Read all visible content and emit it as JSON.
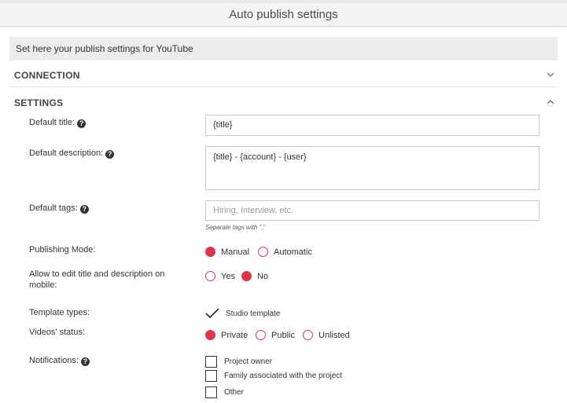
{
  "dialog": {
    "title": "Auto publish settings"
  },
  "intro_text": "Set here your publish settings for YouTube",
  "sections": {
    "connection": {
      "label": "CONNECTION",
      "expanded": false
    },
    "settings": {
      "label": "SETTINGS",
      "expanded": true
    }
  },
  "fields": {
    "default_title": {
      "label": "Default title:",
      "value": "{title}"
    },
    "default_description": {
      "label": "Default description:",
      "value": "{title} - {account} - {user}"
    },
    "default_tags": {
      "label": "Default tags:",
      "placeholder": "Hiring, Interview, etc.",
      "hint": "Separate tags with \",\""
    },
    "publishing_mode": {
      "label": "Publishing Mode:",
      "options": [
        "Manual",
        "Automatic"
      ],
      "selected": "Manual"
    },
    "allow_edit_mobile": {
      "label": "Allow to edit title and description on mobile:",
      "options": [
        "Yes",
        "No"
      ],
      "selected": "No"
    },
    "template_types": {
      "label": "Template types:",
      "options": [
        "Studio template"
      ],
      "checked": [
        "Studio template"
      ]
    },
    "videos_status": {
      "label": "Videos' status:",
      "options": [
        "Private",
        "Public",
        "Unlisted"
      ],
      "selected": "Private"
    },
    "notifications": {
      "label": "Notifications:",
      "options": [
        "Project owner",
        "Family associated with the project",
        "Other"
      ],
      "checked": []
    }
  },
  "colors": {
    "accent": "#e0334c",
    "intro_bg": "#ececec",
    "border": "#c9c9c9"
  },
  "icons": {
    "help": "question-circle-icon",
    "collapsed": "chevron-down-icon",
    "expanded": "chevron-up-icon",
    "checked": "checkmark-icon"
  }
}
